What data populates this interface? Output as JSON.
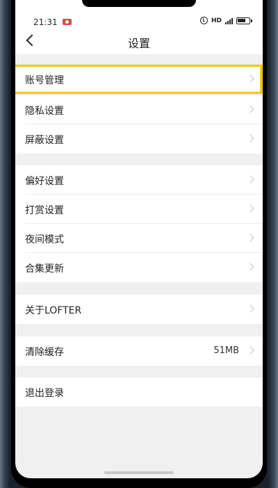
{
  "status_bar": {
    "time": "21:31",
    "hd_label": "HD",
    "icons": [
      "record-icon",
      "alarm-icon",
      "signal-icon",
      "battery-icon"
    ]
  },
  "header": {
    "title": "设置",
    "back_icon": "chevron-left-icon"
  },
  "sections": [
    {
      "items": [
        {
          "label": "账号管理",
          "highlighted": true
        },
        {
          "label": "隐私设置"
        },
        {
          "label": "屏蔽设置"
        }
      ]
    },
    {
      "items": [
        {
          "label": "偏好设置"
        },
        {
          "label": "打赏设置"
        },
        {
          "label": "夜间模式"
        },
        {
          "label": "合集更新"
        }
      ]
    },
    {
      "items": [
        {
          "label": "关于LOFTER"
        }
      ]
    },
    {
      "items": [
        {
          "label": "清除缓存",
          "value": "51MB"
        }
      ]
    },
    {
      "items": [
        {
          "label": "退出登录",
          "no_chevron": true
        }
      ]
    }
  ],
  "colors": {
    "highlight": "#f5c518",
    "background": "#f0f0f0",
    "row": "#ffffff"
  }
}
